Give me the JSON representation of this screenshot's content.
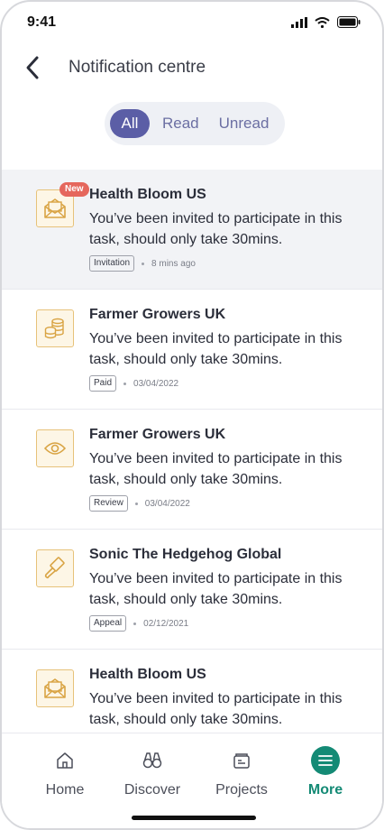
{
  "status_bar": {
    "time": "9:41"
  },
  "header": {
    "title": "Notification centre"
  },
  "filter": {
    "tabs": [
      "All",
      "Read",
      "Unread"
    ],
    "active": "All"
  },
  "notifications": [
    {
      "title": "Health Bloom US",
      "message": "You’ve been invited to participate in this task, should only take 30mins.",
      "tag": "Invitation",
      "time": "8 mins ago",
      "badge": "New",
      "icon": "envelope-icon",
      "is_new": true
    },
    {
      "title": "Farmer Growers UK",
      "message": "You’ve been invited to participate in this task, should only take 30mins.",
      "tag": "Paid",
      "time": "03/04/2022",
      "icon": "coins-icon"
    },
    {
      "title": "Farmer Growers UK",
      "message": "You’ve been invited to participate in this task, should only take 30mins.",
      "tag": "Review",
      "time": "03/04/2022",
      "icon": "eye-icon"
    },
    {
      "title": "Sonic The Hedgehog Global",
      "message": "You’ve been invited to participate in this task, should only take 30mins.",
      "tag": "Appeal",
      "time": "02/12/2021",
      "icon": "gavel-icon"
    },
    {
      "title": "Health Bloom US",
      "message": "You’ve been invited to participate in this task, should only take 30mins.",
      "icon": "envelope-icon"
    }
  ],
  "bottom_nav": {
    "items": [
      {
        "label": "Home",
        "icon": "home-icon"
      },
      {
        "label": "Discover",
        "icon": "binoculars-icon"
      },
      {
        "label": "Projects",
        "icon": "folder-icon"
      },
      {
        "label": "More",
        "icon": "menu-icon"
      }
    ],
    "active": "More"
  },
  "colors": {
    "accent": "#5b5ea6",
    "icon_gold": "#d9a444",
    "nav_active": "#148a75",
    "badge": "#e5675d"
  }
}
